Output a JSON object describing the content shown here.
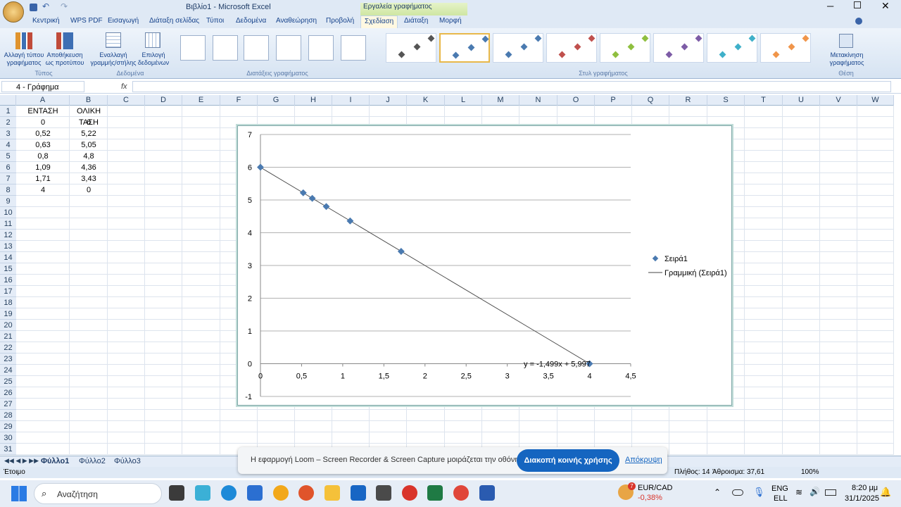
{
  "window": {
    "title": "Βιβλίο1 - Microsoft Excel",
    "context_tab": "Εργαλεία γραφήματος"
  },
  "ribbon_tabs": [
    "Κεντρική",
    "WPS PDF",
    "Εισαγωγή",
    "Διάταξη σελίδας",
    "Τύποι",
    "Δεδομένα",
    "Αναθεώρηση",
    "Προβολή",
    "Σχεδίαση",
    "Διάταξη",
    "Μορφή"
  ],
  "ribbon": {
    "change_type": "Αλλαγή τύπου γραφήματος",
    "save_template": "Αποθήκευση ως προτύπου",
    "group_type": "Τύπος",
    "switch_rowcol": "Εναλλαγή γραμμής/στήλης",
    "select_data": "Επιλογή δεδομένων",
    "group_data": "Δεδομένα",
    "group_layouts": "Διατάξεις γραφήματος",
    "group_styles": "Στυλ γραφήματος",
    "move_chart": "Μετακίνηση γραφήματος",
    "group_location": "Θέση",
    "style_colors": [
      "#555555",
      "#4a7ab0",
      "#4a7ab0",
      "#c0504d",
      "#8fbf3f",
      "#7d5ca6",
      "#3fb0c9",
      "#f0954a"
    ]
  },
  "namebox": "4 - Γράφημα",
  "fx": "fx",
  "columns": [
    "A",
    "B",
    "C",
    "D",
    "E",
    "F",
    "G",
    "H",
    "I",
    "J",
    "K",
    "L",
    "M",
    "N",
    "O",
    "P",
    "Q",
    "R",
    "S",
    "T",
    "U",
    "V",
    "W"
  ],
  "rows": [
    "1",
    "2",
    "3",
    "4",
    "5",
    "6",
    "7",
    "8",
    "9",
    "10",
    "11",
    "12",
    "13",
    "14",
    "15",
    "16",
    "17",
    "18",
    "19",
    "20",
    "21",
    "22",
    "23",
    "24",
    "25",
    "26",
    "27",
    "28",
    "29",
    "30",
    "31"
  ],
  "cells": {
    "A": [
      "ΕΝΤΑΣΗ",
      "0",
      "0,52",
      "0,63",
      "0,8",
      "1,09",
      "1,71",
      "4"
    ],
    "B": [
      "ΟΛΙΚΗ ΤΑΣΗ",
      "6",
      "5,22",
      "5,05",
      "4,8",
      "4,36",
      "3,43",
      "0"
    ]
  },
  "chart_data": {
    "type": "scatter",
    "x": [
      0,
      0.52,
      0.63,
      0.8,
      1.09,
      1.71,
      4
    ],
    "y": [
      6,
      5.22,
      5.05,
      4.8,
      4.36,
      3.43,
      0
    ],
    "xlim": [
      0,
      4.5
    ],
    "ylim": [
      -1,
      7
    ],
    "x_ticks": [
      "0",
      "0,5",
      "1",
      "1,5",
      "2",
      "2,5",
      "3",
      "3,5",
      "4",
      "4,5"
    ],
    "y_ticks": [
      "-1",
      "0",
      "1",
      "2",
      "3",
      "4",
      "5",
      "6",
      "7"
    ],
    "series": [
      {
        "name": "Σειρά1",
        "color": "#4a7ab0"
      }
    ],
    "trendline": {
      "name": "Γραμμική (Σειρά1)",
      "slope": -1.499,
      "intercept": 5.997,
      "equation": "y = -1,499x + 5,997"
    },
    "grid": true,
    "legend": "right"
  },
  "sheets": [
    "Φύλλο1",
    "Φύλλο2",
    "Φύλλο3"
  ],
  "status": {
    "ready": "Έτοιμο",
    "count": "Πλήθος: 14",
    "sum": "Άθροισμα: 37,61",
    "zoom": "100%"
  },
  "loom": {
    "message": "Η εφαρμογή Loom – Screen Recorder & Screen Capture μοιράζεται την οθόνη σας.",
    "stop": "Διακοπή κοινής χρήσης",
    "hide": "Απόκρυψη"
  },
  "taskbar": {
    "search": "Αναζήτηση",
    "ticker": "EUR/CAD",
    "ticker_change": "-0,38%",
    "lang1": "ENG",
    "lang2": "ELL",
    "time": "8:20 μμ",
    "date": "31/1/2025",
    "badge": "7"
  }
}
